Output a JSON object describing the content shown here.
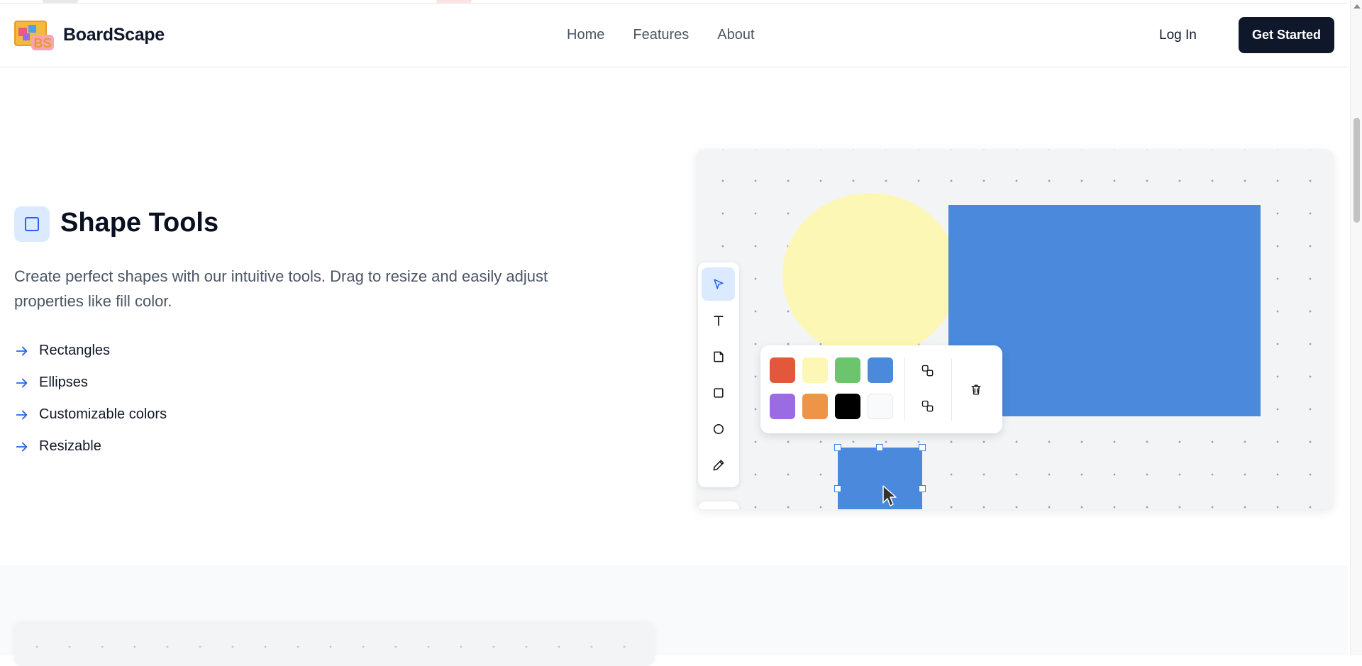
{
  "header": {
    "brand": "BoardScape",
    "nav": [
      "Home",
      "Features",
      "About"
    ],
    "login_label": "Log In",
    "cta_label": "Get Started",
    "logo_text": "BS"
  },
  "feature": {
    "title": "Shape Tools",
    "description": "Create perfect shapes with our intuitive tools. Drag to resize and easily adjust properties like fill color.",
    "items": [
      "Rectangles",
      "Ellipses",
      "Customizable colors",
      "Resizable"
    ]
  },
  "canvas_demo": {
    "tools": [
      "select-icon",
      "text-icon",
      "sticky-note-icon",
      "rectangle-icon",
      "ellipse-icon",
      "pencil-icon"
    ],
    "active_tool": "select-icon",
    "colors": [
      "#e2583a",
      "#fdf7b6",
      "#6cc46d",
      "#4a89dc",
      "#9b6be3",
      "#ee9447",
      "#000000",
      "#f9fafb"
    ],
    "shape_colors": {
      "ellipse": "#fdf7b6",
      "rectangle": "#4a89dc"
    }
  },
  "theme": {
    "accent": "#2563eb",
    "dark": "#0f172a"
  }
}
